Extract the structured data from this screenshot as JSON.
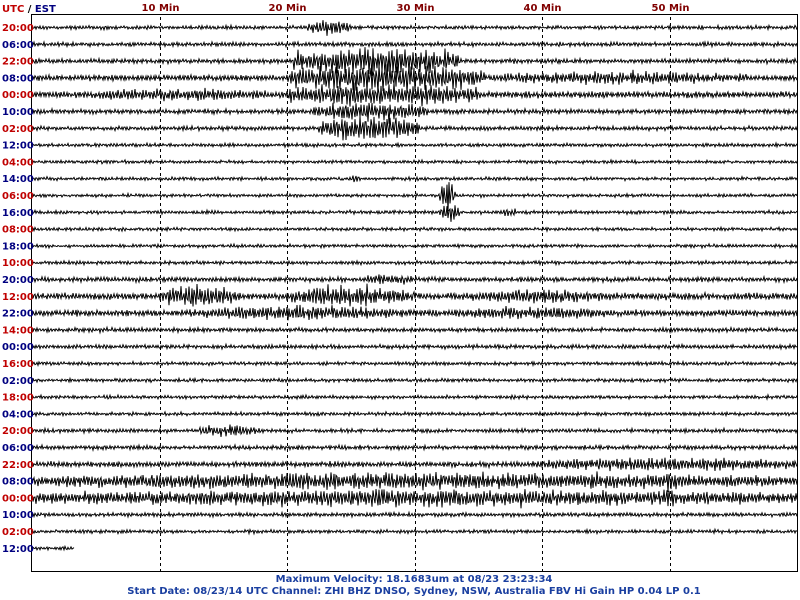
{
  "header": {
    "timezone_primary": "UTC",
    "timezone_separator": " / ",
    "timezone_secondary": "EST"
  },
  "chart_data": {
    "type": "line",
    "subtype": "helicorder",
    "x_axis": {
      "unit": "Min",
      "range": [
        0,
        60
      ],
      "tick_values": [
        10,
        20,
        30,
        40,
        50
      ],
      "tick_labels": [
        "10 Min",
        "20 Min",
        "30 Min",
        "40 Min",
        "50 Min"
      ]
    },
    "utc_labels": [
      "20:00",
      "22:00",
      "00:00",
      "02:00",
      "04:00",
      "06:00",
      "08:00",
      "10:00",
      "12:00",
      "14:00",
      "16:00",
      "18:00",
      "20:00",
      "22:00",
      "00:00",
      "02:00"
    ],
    "est_labels": [
      "06:00",
      "08:00",
      "10:00",
      "12:00",
      "14:00",
      "16:00",
      "18:00",
      "20:00",
      "22:00",
      "00:00",
      "02:00",
      "04:00",
      "06:00",
      "08:00",
      "10:00",
      "12:00"
    ],
    "trace_count": 32,
    "traces_per_label": 2,
    "last_trace_fraction": 0.055,
    "trace_activity": [
      {
        "trace": 0,
        "level": 0.18,
        "bursts": [
          {
            "start": 21.5,
            "end": 25.0,
            "amp": 1.6
          }
        ]
      },
      {
        "trace": 1,
        "level": 0.25,
        "bursts": []
      },
      {
        "trace": 2,
        "level": 0.3,
        "bursts": [
          {
            "start": 20.5,
            "end": 33.5,
            "amp": 3.2
          }
        ]
      },
      {
        "trace": 3,
        "level": 0.45,
        "bursts": [
          {
            "start": 20.0,
            "end": 35.5,
            "amp": 3.0
          },
          {
            "start": 36.0,
            "end": 56.0,
            "amp": 1.4
          }
        ]
      },
      {
        "trace": 4,
        "level": 0.55,
        "bursts": [
          {
            "start": 3.0,
            "end": 20.0,
            "amp": 1.3
          },
          {
            "start": 20.0,
            "end": 35.0,
            "amp": 2.6
          }
        ]
      },
      {
        "trace": 5,
        "level": 0.3,
        "bursts": [
          {
            "start": 22.0,
            "end": 31.0,
            "amp": 2.2
          }
        ]
      },
      {
        "trace": 6,
        "level": 0.25,
        "bursts": [
          {
            "start": 22.5,
            "end": 30.5,
            "amp": 3.0
          }
        ]
      },
      {
        "trace": 7,
        "level": 0.15,
        "bursts": []
      },
      {
        "trace": 8,
        "level": 0.12,
        "bursts": []
      },
      {
        "trace": 9,
        "level": 0.12,
        "bursts": [
          {
            "start": 25.0,
            "end": 25.8,
            "amp": 1.0
          }
        ]
      },
      {
        "trace": 10,
        "level": 0.12,
        "bursts": [
          {
            "start": 32.0,
            "end": 33.2,
            "amp": 3.5
          }
        ]
      },
      {
        "trace": 11,
        "level": 0.15,
        "bursts": [
          {
            "start": 32.0,
            "end": 33.5,
            "amp": 2.0
          },
          {
            "start": 37.0,
            "end": 38.0,
            "amp": 1.0
          }
        ]
      },
      {
        "trace": 12,
        "level": 0.12,
        "bursts": []
      },
      {
        "trace": 13,
        "level": 0.12,
        "bursts": []
      },
      {
        "trace": 14,
        "level": 0.15,
        "bursts": []
      },
      {
        "trace": 15,
        "level": 0.3,
        "bursts": [
          {
            "start": 26.0,
            "end": 30.0,
            "amp": 1.3
          }
        ]
      },
      {
        "trace": 16,
        "level": 0.55,
        "bursts": [
          {
            "start": 10.0,
            "end": 16.0,
            "amp": 2.5
          },
          {
            "start": 20.0,
            "end": 30.0,
            "amp": 2.3
          },
          {
            "start": 34.0,
            "end": 45.0,
            "amp": 1.5
          }
        ]
      },
      {
        "trace": 17,
        "level": 0.5,
        "bursts": [
          {
            "start": 12.0,
            "end": 30.0,
            "amp": 1.6
          },
          {
            "start": 33.0,
            "end": 46.0,
            "amp": 1.4
          }
        ]
      },
      {
        "trace": 18,
        "level": 0.25,
        "bursts": []
      },
      {
        "trace": 19,
        "level": 0.22,
        "bursts": []
      },
      {
        "trace": 20,
        "level": 0.15,
        "bursts": []
      },
      {
        "trace": 21,
        "level": 0.15,
        "bursts": []
      },
      {
        "trace": 22,
        "level": 0.15,
        "bursts": []
      },
      {
        "trace": 23,
        "level": 0.15,
        "bursts": []
      },
      {
        "trace": 24,
        "level": 0.2,
        "bursts": [
          {
            "start": 13.0,
            "end": 18.0,
            "amp": 1.4
          }
        ]
      },
      {
        "trace": 25,
        "level": 0.25,
        "bursts": []
      },
      {
        "trace": 26,
        "level": 0.4,
        "bursts": [
          {
            "start": 39.0,
            "end": 60.0,
            "amp": 1.5
          }
        ]
      },
      {
        "trace": 27,
        "level": 0.9,
        "bursts": [
          {
            "start": 0.0,
            "end": 60.0,
            "amp": 1.9
          },
          {
            "start": 49.5,
            "end": 50.5,
            "amp": 3.0
          }
        ]
      },
      {
        "trace": 28,
        "level": 0.9,
        "bursts": [
          {
            "start": 0.0,
            "end": 60.0,
            "amp": 1.9
          },
          {
            "start": 49.5,
            "end": 50.5,
            "amp": 2.5
          }
        ]
      },
      {
        "trace": 29,
        "level": 0.2,
        "bursts": []
      },
      {
        "trace": 30,
        "level": 0.15,
        "bursts": []
      },
      {
        "trace": 31,
        "level": 0.12,
        "bursts": []
      }
    ]
  },
  "footer": {
    "max_velocity": "Maximum Velocity: 18.1683um at 08/23 23:23:34",
    "start_info": "Start Date: 08/23/14 UTC Channel: ZHI  BHZ  DNSO, Sydney, NSW, Australia  FBV Hi Gain HP 0.04 LP 0.1"
  },
  "colors": {
    "trace": "#000000",
    "utc_label": "#c00000",
    "est_label": "#000080",
    "footer_text": "#1a3fa0",
    "grid": "#000000"
  }
}
